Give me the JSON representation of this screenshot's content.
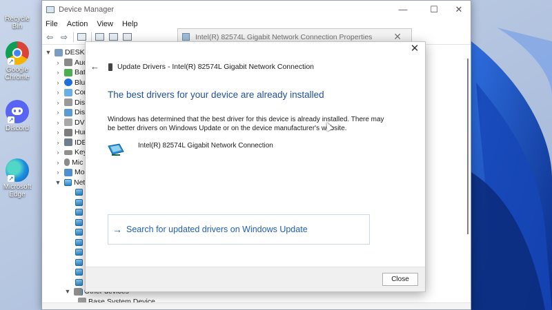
{
  "desktop": {
    "icons": [
      {
        "label": "Recycle Bin",
        "icon": "recycle-bin-icon"
      },
      {
        "label": "Google Chrome",
        "icon": "chrome-icon"
      },
      {
        "label": "Discord",
        "icon": "discord-icon"
      },
      {
        "label": "Microsoft Edge",
        "icon": "edge-icon"
      }
    ]
  },
  "device_manager": {
    "title": "Device Manager",
    "controls": {
      "minimize": "—",
      "maximize": "☐",
      "close": "✕"
    },
    "menu": [
      "File",
      "Action",
      "View",
      "Help"
    ],
    "tree": {
      "root": "DESKTOP",
      "categories": [
        {
          "label": "Aud",
          "icon": "audio-icon"
        },
        {
          "label": "Batt",
          "icon": "battery-icon"
        },
        {
          "label": "Blue",
          "icon": "bluetooth-icon"
        },
        {
          "label": "Com",
          "icon": "computer-icon"
        },
        {
          "label": "Disk",
          "icon": "disk-drive-icon"
        },
        {
          "label": "Disp",
          "icon": "display-adapter-icon"
        },
        {
          "label": "DVD",
          "icon": "dvd-drive-icon"
        },
        {
          "label": "Hum",
          "icon": "hid-icon"
        },
        {
          "label": "IDE",
          "icon": "ide-controller-icon"
        },
        {
          "label": "Key",
          "icon": "keyboard-icon"
        },
        {
          "label": "Mic",
          "icon": "mouse-icon"
        },
        {
          "label": "Mo",
          "icon": "monitor-icon"
        },
        {
          "label": "Net",
          "icon": "network-adapter-icon"
        }
      ],
      "network_children_count": 11,
      "other_devices": "Other devices",
      "other_child": "Base System Device"
    },
    "properties_tab": {
      "title": "Intel(R) 82574L Gigabit Network Connection Properties",
      "close": "✕"
    }
  },
  "update_drivers": {
    "close_glyph": "✕",
    "back_glyph": "←",
    "header": "Update Drivers - Intel(R) 82574L Gigabit Network Connection",
    "heading": "The best drivers for your device are already installed",
    "body": "Windows has determined that the best driver for this device is already installed. There may be better drivers on Windows Update or on the device manufacturer's website.",
    "device_name": "Intel(R) 82574L Gigabit Network Connection",
    "search_arrow": "→",
    "search_label": "Search for updated drivers on Windows Update",
    "close_button": "Close"
  }
}
